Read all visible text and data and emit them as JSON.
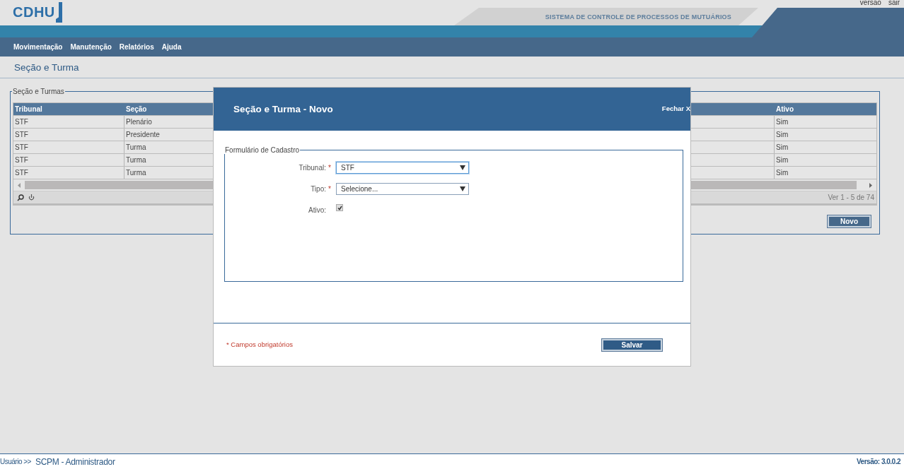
{
  "header": {
    "logo": "CDHU",
    "links": [
      "versao",
      "sair"
    ],
    "system_title": "SISTEMA DE CONTROLE DE PROCESSOS DE MUTUÁRIOS"
  },
  "menu": [
    "Movimentação",
    "Manutenção",
    "Relatórios",
    "Ajuda"
  ],
  "page_title": "Seção e Turma",
  "list": {
    "legend": "Seção e Turmas",
    "columns": [
      "Tribunal",
      "Seção",
      "Ativo"
    ],
    "rows": [
      {
        "tribunal": "STF",
        "secao": "Plenário",
        "ativo": "Sim"
      },
      {
        "tribunal": "STF",
        "secao": "Presidente",
        "ativo": "Sim"
      },
      {
        "tribunal": "STF",
        "secao": "Turma",
        "ativo": "Sim"
      },
      {
        "tribunal": "STF",
        "secao": "Turma",
        "ativo": "Sim"
      },
      {
        "tribunal": "STF",
        "secao": "Turma",
        "ativo": "Sim"
      }
    ],
    "pager": "Ver 1 - 5 de 74",
    "new_button": "Novo"
  },
  "modal": {
    "title": "Seção e Turma - Novo",
    "close": "Fechar X",
    "legend": "Formulário de Cadastro",
    "fields": [
      {
        "kind": "select",
        "label": "Tribunal:",
        "required_mark": "*",
        "value": "STF",
        "focused": true
      },
      {
        "kind": "select",
        "label": "Tipo:",
        "required_mark": "*",
        "value": "Selecione...",
        "focused": false
      },
      {
        "kind": "checkbox",
        "label": "Ativo:",
        "checked": true
      }
    ],
    "required_note": "* Campos obrigatórios",
    "save": "Salvar"
  },
  "footer": {
    "user_label": "Usuário >>",
    "user": "SCPM - Administrador",
    "version": "Versão: 3.0.0.2"
  }
}
